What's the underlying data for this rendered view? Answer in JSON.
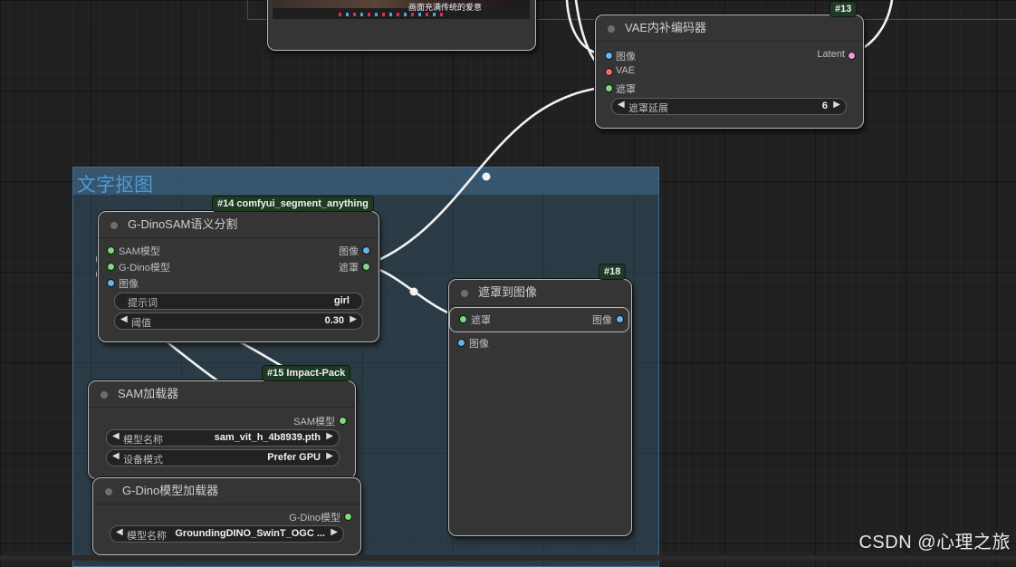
{
  "group": {
    "title": "文字抠图"
  },
  "preview_node": {
    "caption": "画面充满传统的爱意"
  },
  "vae_node": {
    "id": "#13",
    "title": "VAE内补编码器",
    "inputs": [
      "图像",
      "VAE",
      "遮罩"
    ],
    "output": "Latent",
    "widget": {
      "label": "遮罩延展",
      "value": "6"
    }
  },
  "gdino_sam_node": {
    "id": "#14 comfyui_segment_anything",
    "title": "G-DinoSAM语义分割",
    "inputs": [
      "SAM模型",
      "G-Dino模型",
      "图像"
    ],
    "outputs": [
      "图像",
      "遮罩"
    ],
    "prompt_widget": {
      "label": "提示词",
      "value": "girl"
    },
    "threshold_widget": {
      "label": "阈值",
      "value": "0.30"
    }
  },
  "mask_to_image_node": {
    "id": "#18",
    "title": "遮罩到图像",
    "input": "遮罩",
    "output": "图像",
    "extra_slot": "图像"
  },
  "sam_loader_node": {
    "id": "#15 Impact-Pack",
    "title": "SAM加载器",
    "output": "SAM模型",
    "model_widget": {
      "label": "模型名称",
      "value": "sam_vit_h_4b8939.pth"
    },
    "device_widget": {
      "label": "设备模式",
      "value": "Prefer GPU"
    }
  },
  "gdino_loader_node": {
    "title": "G-Dino模型加载器",
    "output": "G-Dino模型",
    "model_widget": {
      "label": "模型名称",
      "value": "GroundingDINO_SwinT_OGC ..."
    }
  },
  "watermark": "CSDN @心理之旅",
  "colors": {
    "mask_slot": "#7cdb7c",
    "image_slot": "#63b4f2",
    "latent_slot": "#f49bd4",
    "vae_slot": "#ef6a6a",
    "group_title": "#4e9ad6",
    "badge_bg": "#1f3a22"
  }
}
